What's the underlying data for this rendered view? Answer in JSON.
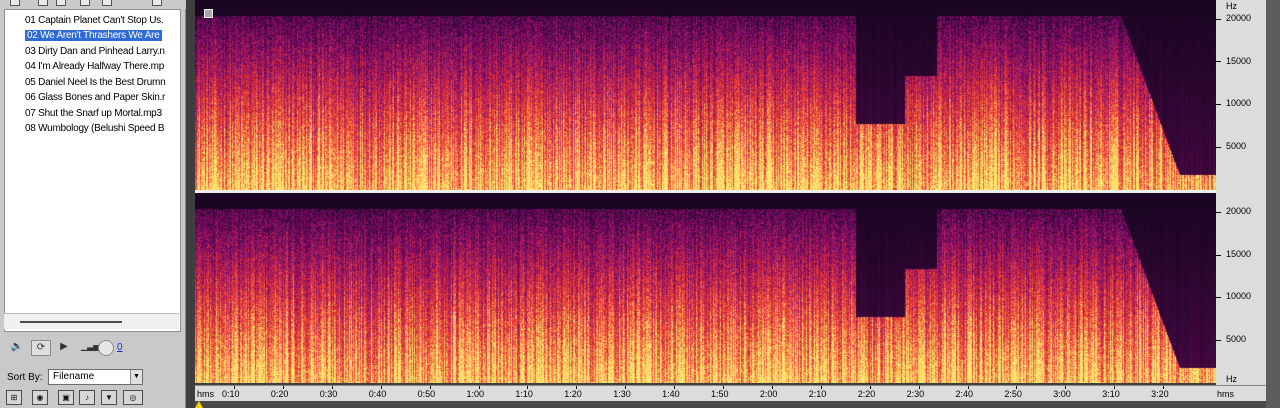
{
  "files": [
    {
      "name": "01 Captain Planet Can't Stop Us.",
      "selected": false
    },
    {
      "name": "02 We Aren't Thrashers We Are",
      "selected": true
    },
    {
      "name": "03 Dirty Dan and Pinhead Larry.n",
      "selected": false
    },
    {
      "name": "04 I'm Already Halfway There.mp",
      "selected": false
    },
    {
      "name": "05 Daniel Neel Is the Best Drumn",
      "selected": false
    },
    {
      "name": "06 Glass Bones and Paper Skin.r",
      "selected": false
    },
    {
      "name": "07 Shut the Snarf up Mortal.mp3",
      "selected": false
    },
    {
      "name": "08 Wumbology (Belushi Speed B",
      "selected": false
    }
  ],
  "transport": {
    "play_symbol": "▶",
    "volume_value": "0"
  },
  "sort": {
    "label": "Sort By:",
    "value": "Filename"
  },
  "frequency_axis": {
    "unit": "Hz",
    "labels": [
      "20000",
      "15000",
      "10000",
      "5000"
    ]
  },
  "time_axis": {
    "start_label": "hms",
    "end_label": "hms",
    "labels": [
      "0:10",
      "0:20",
      "0:30",
      "0:40",
      "0:50",
      "1:00",
      "1:10",
      "1:20",
      "1:30",
      "1:40",
      "1:50",
      "2:00",
      "2:10",
      "2:20",
      "2:30",
      "2:40",
      "2:50",
      "3:00",
      "3:10",
      "3:20"
    ]
  },
  "colors": {
    "panel_bg": "#c9c9c9",
    "selection": "#2f6ad7",
    "spectro_low": "#0a0710",
    "spectro_mid": "#c0183a",
    "spectro_high": "#ffe070",
    "playhead": "#f4d400"
  }
}
